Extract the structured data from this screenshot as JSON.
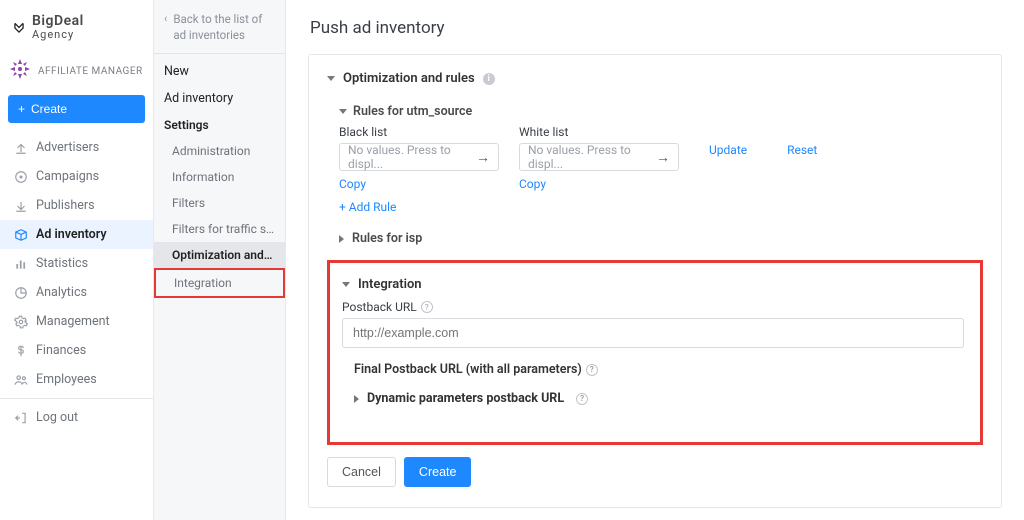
{
  "brand": {
    "name": "BigDeal",
    "sub": "Agency"
  },
  "role": "AFFILIATE MANAGER",
  "create_label": "Create",
  "nav": {
    "advertisers": "Advertisers",
    "campaigns": "Campaigns",
    "publishers": "Publishers",
    "ad_inventory": "Ad inventory",
    "statistics": "Statistics",
    "analytics": "Analytics",
    "management": "Management",
    "finances": "Finances",
    "employees": "Employees",
    "logout": "Log out"
  },
  "sub": {
    "back": "Back to the list of ad inventories",
    "new": "New",
    "ad_inventory": "Ad inventory",
    "settings": "Settings",
    "items": {
      "administration": "Administration",
      "information": "Information",
      "filters": "Filters",
      "filters_traffic": "Filters for traffic sour...",
      "optimization": "Optimization and rules",
      "integration": "Integration"
    }
  },
  "page_title": "Push ad inventory",
  "opt": {
    "title": "Optimization and rules",
    "rules_utm": "Rules for utm_source",
    "black_list": "Black list",
    "white_list": "White list",
    "placeholder": "No values. Press to displ...",
    "copy": "Copy",
    "update": "Update",
    "reset": "Reset",
    "add_rule": "+ Add Rule",
    "isp": "Rules for isp"
  },
  "integration": {
    "title": "Integration",
    "postback": "Postback URL",
    "postback_ph": "http://example.com",
    "final": "Final Postback URL (with all parameters)",
    "dynamic": "Dynamic parameters postback URL"
  },
  "actions": {
    "cancel": "Cancel",
    "create": "Create"
  }
}
